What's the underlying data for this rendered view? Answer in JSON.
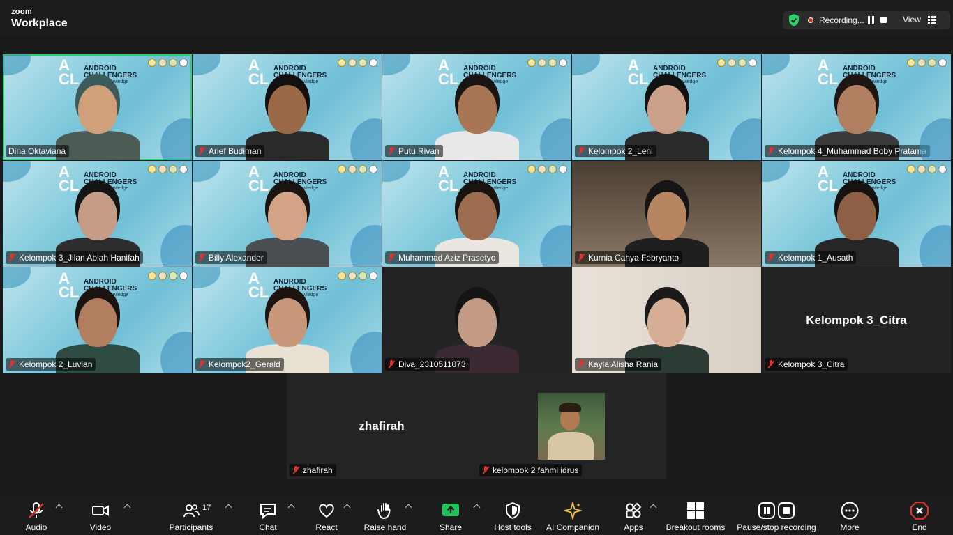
{
  "app": {
    "brand_top": "zoom",
    "brand_bottom": "Workplace"
  },
  "header": {
    "recording_label": "Recording...",
    "view_label": "View"
  },
  "participants": [
    {
      "name": "Dina Oktaviana",
      "muted": false,
      "style": "bg",
      "active": true
    },
    {
      "name": "Arief Budiman",
      "muted": true,
      "style": "bg"
    },
    {
      "name": "Putu Rivan",
      "muted": true,
      "style": "bg"
    },
    {
      "name": "Kelompok 2_Leni",
      "muted": true,
      "style": "bg"
    },
    {
      "name": "Kelompok 4_Muhammad Boby Pratama",
      "muted": true,
      "style": "bg"
    },
    {
      "name": "Kelompok 3_Jilan Ablah Hanifah",
      "muted": true,
      "style": "bg"
    },
    {
      "name": "Billy Alexander",
      "muted": true,
      "style": "bg"
    },
    {
      "name": "Muhammad Aziz Prasetyo",
      "muted": true,
      "style": "bg"
    },
    {
      "name": "Kurnia Cahya Febryanto",
      "muted": true,
      "style": "room"
    },
    {
      "name": "Kelompok 1_Ausath",
      "muted": true,
      "style": "bg"
    },
    {
      "name": "Kelompok 2_Luvian",
      "muted": true,
      "style": "bg"
    },
    {
      "name": "Kelompok2_Gerald",
      "muted": true,
      "style": "bg"
    },
    {
      "name": "Diva_2310511073",
      "muted": true,
      "style": "dark"
    },
    {
      "name": "Kayla Alisha Rania",
      "muted": true,
      "style": "wall"
    },
    {
      "name": "Kelompok 3_Citra",
      "muted": true,
      "style": "dark",
      "video_off_label": "Kelompok 3_Citra"
    }
  ],
  "bottom_participants": [
    {
      "name": "zhafirah",
      "video_off_label": "zhafirah"
    },
    {
      "name": "kelompok 2 fahmi idrus"
    }
  ],
  "background_brand": {
    "line1": "ANDROID",
    "line2": "CHALLENGERS",
    "tagline": "#DiveIntoKnowledge"
  },
  "toolbar": {
    "audio": "Audio",
    "video": "Video",
    "participants": "Participants",
    "participants_count": "17",
    "chat": "Chat",
    "react": "React",
    "raise_hand": "Raise hand",
    "share": "Share",
    "host_tools": "Host tools",
    "ai_companion": "AI Companion",
    "apps": "Apps",
    "breakout_rooms": "Breakout rooms",
    "pause_stop_recording": "Pause/stop recording",
    "more": "More",
    "end": "End"
  },
  "colors": {
    "accent_green": "#2bd46b",
    "share_green": "#1fc35a",
    "end_red": "#e0322b",
    "ai_gold": "#f2c043"
  }
}
